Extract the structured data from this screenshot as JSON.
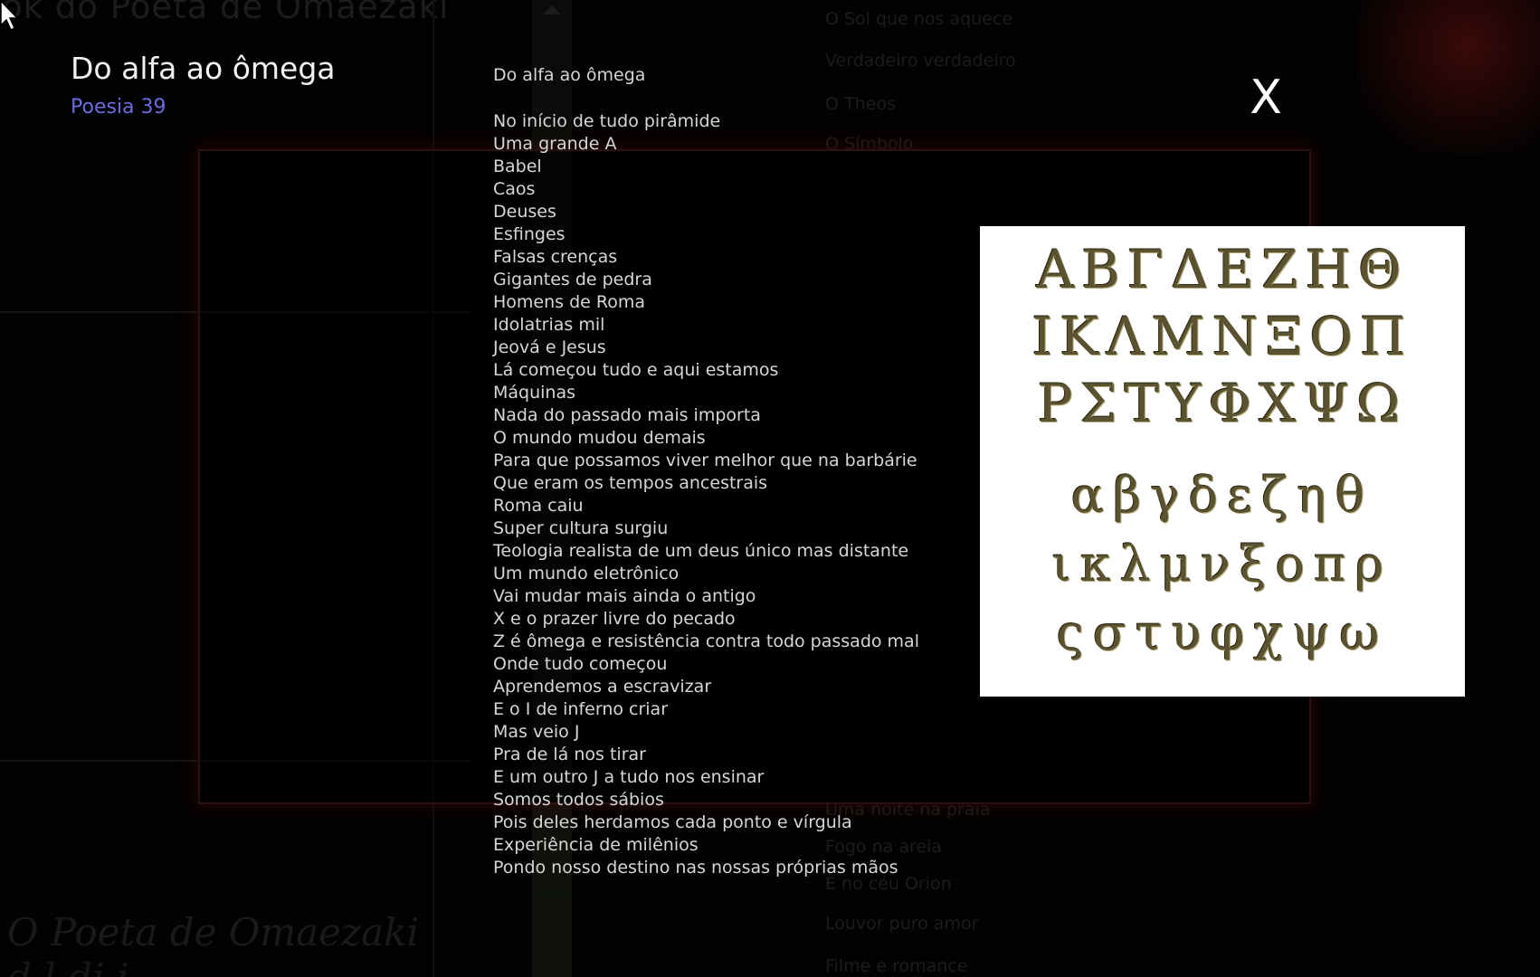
{
  "background": {
    "site_title": "ok do Poeta de Omaezaki",
    "menu_items": [
      "O Sol que nos aquece",
      "Verdadeiro  verdadeiro",
      "O Theos",
      "O Símbolo",
      "Uma noite na praia",
      "Fogo na areia",
      "E no céu Orion",
      "Louvor puro amor",
      "Filme e romance"
    ],
    "footer_italic": "O Poeta de Omaezaki",
    "footer_italic_2": "d     l  di  i"
  },
  "poem": {
    "title": "Do alfa ao ômega",
    "subtitle": "Poesia 39",
    "heading": "Do alfa ao ômega",
    "lines": [
      "No início de tudo pirâmide",
      "Uma grande A",
      "Babel",
      "Caos",
      "Deuses",
      "Esfinges",
      "Falsas crenças",
      "Gigantes de pedra",
      "Homens de Roma",
      "Idolatrias mil",
      "Jeová e Jesus",
      "Lá começou tudo e aqui estamos",
      "Máquinas",
      "Nada do passado mais importa",
      "O mundo mudou demais",
      "Para que possamos viver melhor que na barbárie",
      "Que eram os tempos ancestrais",
      "Roma caiu",
      "Super cultura surgiu",
      "Teologia realista de um deus único mas distante",
      "Um mundo eletrônico",
      "Vai mudar mais ainda o antigo",
      "X e o prazer livre do pecado",
      "Z é ômega e resistência contra todo passado mal",
      "Onde tudo começou",
      "Aprendemos a escravizar",
      "E o I de inferno criar",
      "Mas veio J",
      "Pra de lá nos tirar",
      "E um outro J a tudo nos ensinar",
      "Somos todos sábios",
      "Pois deles herdamos cada ponto e vírgula",
      "Experiência de milênios",
      "Pondo nosso destino nas nossas próprias mãos"
    ]
  },
  "close_button": {
    "label": "X"
  },
  "greek_alphabet": {
    "upper": [
      "ΑΒΓΔΕΖΗΘ",
      "ΙΚΛΜΝΞΟΠ",
      "ΡΣΤΥΦΧΨΩ"
    ],
    "lower": [
      "αβγδεζηθ",
      "ικλμνξοπρ",
      "ςστυφχψω"
    ]
  },
  "colors": {
    "background": "#030202",
    "poem_text": "#d6d6d6",
    "subtitle": "#6b6be0",
    "greek_letters": "#5a5230",
    "frame_glow": "#5a0a0a"
  }
}
